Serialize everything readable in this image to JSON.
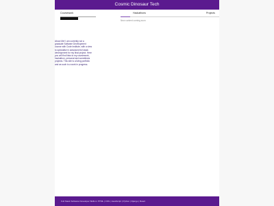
{
  "header": {
    "title": "Cosmic Dinosaur Tech"
  },
  "tabs": [
    {
      "label": "Coursework"
    },
    {
      "label": "Hackathons"
    },
    {
      "label": "Projects"
    }
  ],
  "status": {
    "text": "New content coming soon"
  },
  "about": {
    "text": "About Me! I am currently not a graduate Software Development course with Code Institute, with a view to specialise in advanced full stack development for my final project. Here you will find links to my coursework, hackathon, personal and sometimes projects. This site is a living portfolio and as such is a work in progress."
  },
  "footer": {
    "text": "Full Stack Software Developer Skills in HTML | CSS | JavaScript | Python | Django | React"
  },
  "colors": {
    "brand_purple": "#5b1a8f",
    "accent_purple": "#7d4ab3"
  }
}
